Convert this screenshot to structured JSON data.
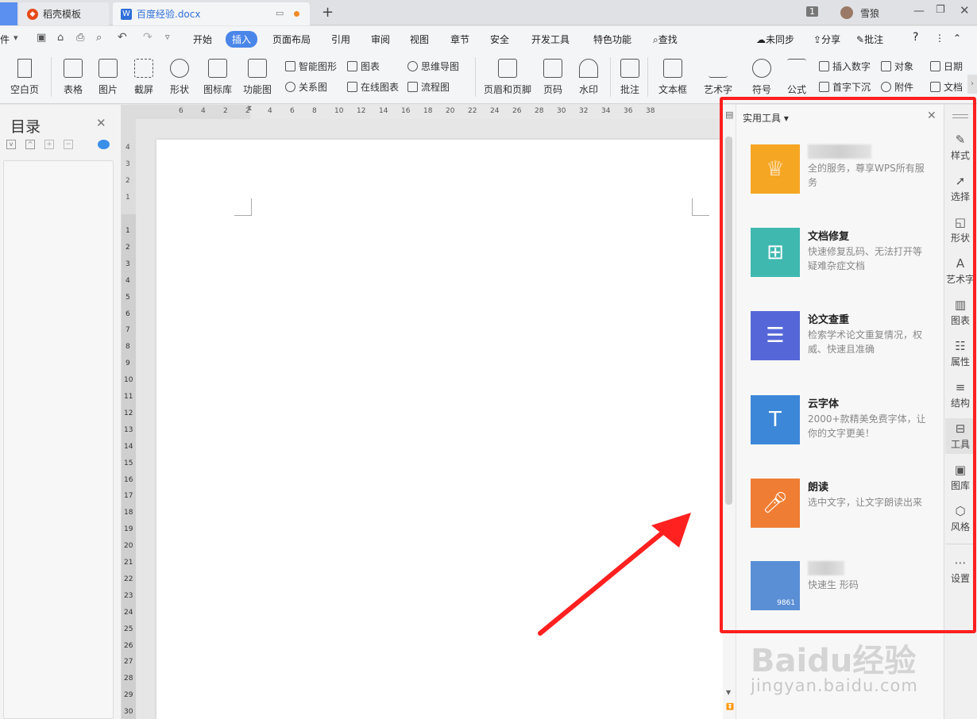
{
  "tabs": {
    "first_partial": "件",
    "template_tab": "稻壳模板",
    "doc_tab": "百度经验.docx",
    "new_tab": "+",
    "badge": "1",
    "user": "雪狼"
  },
  "menu": {
    "items": [
      "开始",
      "插入",
      "页面布局",
      "引用",
      "审阅",
      "视图",
      "章节",
      "安全",
      "开发工具",
      "特色功能"
    ],
    "active": "插入",
    "search": "查找",
    "sync": "未同步",
    "share": "分享",
    "annotate": "批注",
    "help": "?"
  },
  "ribbon": {
    "blank_page": "空白页",
    "table": "表格",
    "picture": "图片",
    "screenshot": "截屏",
    "shape": "形状",
    "icon_lib": "图标库",
    "func_chart": "功能图",
    "smart_shape": "智能图形",
    "chart": "图表",
    "mindmap": "思维导图",
    "relation": "关系图",
    "online_chart": "在线图表",
    "flowchart": "流程图",
    "header_footer": "页眉和页脚",
    "page_num": "页码",
    "watermark": "水印",
    "comment": "批注",
    "textbox": "文本框",
    "art_text": "艺术字",
    "symbol": "符号",
    "formula": "公式",
    "insert_number": "插入数字",
    "object": "对象",
    "date": "日期",
    "dropcap": "首字下沉",
    "attachment": "附件",
    "doc": "文档"
  },
  "nav": {
    "title": "目录"
  },
  "ruler": {
    "top": [
      "6",
      "4",
      "2",
      "2",
      "4",
      "6",
      "8",
      "10",
      "12",
      "14",
      "16",
      "18",
      "20",
      "22",
      "24",
      "26",
      "28",
      "30",
      "32",
      "34",
      "36",
      "38"
    ],
    "left_up": [
      "4",
      "3",
      "2",
      "1"
    ],
    "left_down": [
      "1",
      "2",
      "3",
      "4",
      "5",
      "6",
      "7",
      "8",
      "9",
      "10",
      "11",
      "12",
      "13",
      "14",
      "15",
      "16",
      "17",
      "18",
      "19",
      "20",
      "21",
      "22",
      "23",
      "24",
      "25",
      "26",
      "27",
      "28",
      "29",
      "30"
    ]
  },
  "panel": {
    "title": "实用工具",
    "tools": [
      {
        "name": "会员",
        "desc": "全的服务，尊享WPS所有服务",
        "color": "#f5a623",
        "icon": "crown-icon"
      },
      {
        "name": "文档修复",
        "desc": "快速修复乱码、无法打开等疑难杂症文档",
        "color": "#3fb8b0",
        "icon": "repair-icon"
      },
      {
        "name": "论文查重",
        "desc": "检索学术论文重复情况，权威、快速且准确",
        "color": "#5567d8",
        "icon": "paper-check-icon"
      },
      {
        "name": "云字体",
        "desc": "2000+款精美免费字体，让你的文字更美！",
        "color": "#3d87d9",
        "icon": "cloud-font-icon"
      },
      {
        "name": "朗读",
        "desc": "选中文字，让文字朗读出来",
        "color": "#ef7d33",
        "icon": "microphone-icon"
      },
      {
        "name": "",
        "desc": "快速生  形码",
        "color": "#5a8fd6",
        "icon": "barcode-icon",
        "code": "9861"
      }
    ]
  },
  "sidebar": {
    "items": [
      "样式",
      "选择",
      "形状",
      "艺术字",
      "图表",
      "属性",
      "结构",
      "工具",
      "图库",
      "风格",
      "设置"
    ]
  },
  "watermark": {
    "brand": "Baidu经验",
    "url": "jingyan.baidu.com"
  },
  "colors": {
    "accent": "#4a86e8",
    "highlight": "#ff1f1f"
  }
}
